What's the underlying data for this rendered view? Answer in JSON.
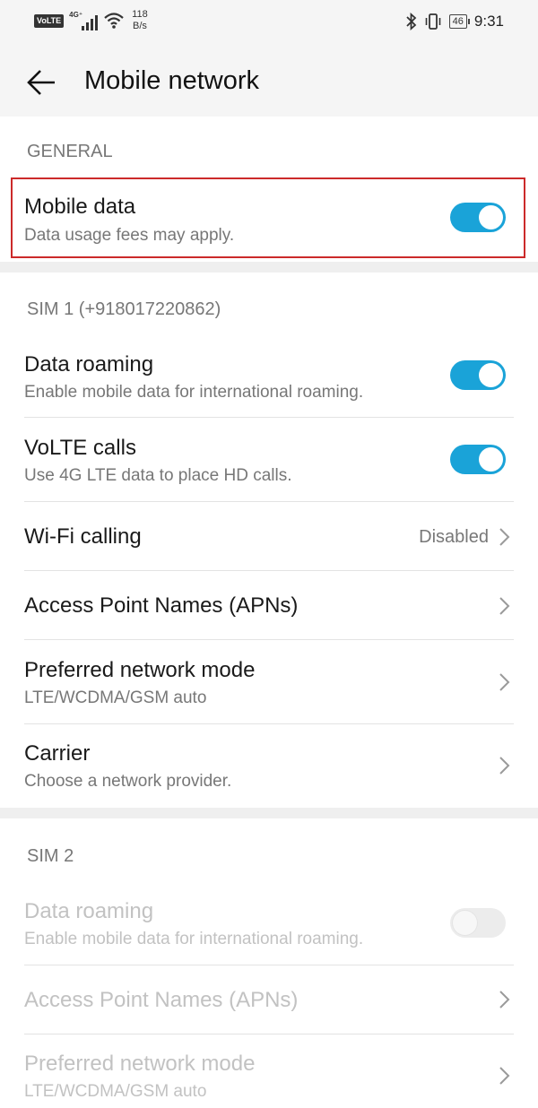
{
  "status_bar": {
    "volte": "VoLTE",
    "net_type": "4G⁺",
    "speed_value": "118",
    "speed_unit": "B/s",
    "battery": "46",
    "time": "9:31"
  },
  "header": {
    "title": "Mobile network"
  },
  "general": {
    "header": "GENERAL",
    "mobile_data": {
      "title": "Mobile data",
      "subtitle": "Data usage fees may apply.",
      "enabled": true
    }
  },
  "sim1": {
    "header": "SIM 1 (+918017220862)",
    "data_roaming": {
      "title": "Data roaming",
      "subtitle": "Enable mobile data for international roaming.",
      "enabled": true
    },
    "volte_calls": {
      "title": "VoLTE calls",
      "subtitle": "Use 4G LTE data to place HD calls.",
      "enabled": true
    },
    "wifi_calling": {
      "title": "Wi-Fi calling",
      "value": "Disabled"
    },
    "apns": {
      "title": "Access Point Names (APNs)"
    },
    "preferred_mode": {
      "title": "Preferred network mode",
      "subtitle": "LTE/WCDMA/GSM auto"
    },
    "carrier": {
      "title": "Carrier",
      "subtitle": "Choose a network provider."
    }
  },
  "sim2": {
    "header": "SIM 2",
    "data_roaming": {
      "title": "Data roaming",
      "subtitle": "Enable mobile data for international roaming.",
      "enabled": false
    },
    "apns": {
      "title": "Access Point Names (APNs)"
    },
    "preferred_mode": {
      "title": "Preferred network mode",
      "subtitle": "LTE/WCDMA/GSM auto"
    }
  },
  "colors": {
    "accent": "#1aa3d8",
    "highlight": "#cc2a2a"
  },
  "icons": [
    "back-arrow-icon",
    "wifi-icon",
    "bluetooth-icon",
    "vibrate-icon",
    "chevron-right-icon"
  ]
}
